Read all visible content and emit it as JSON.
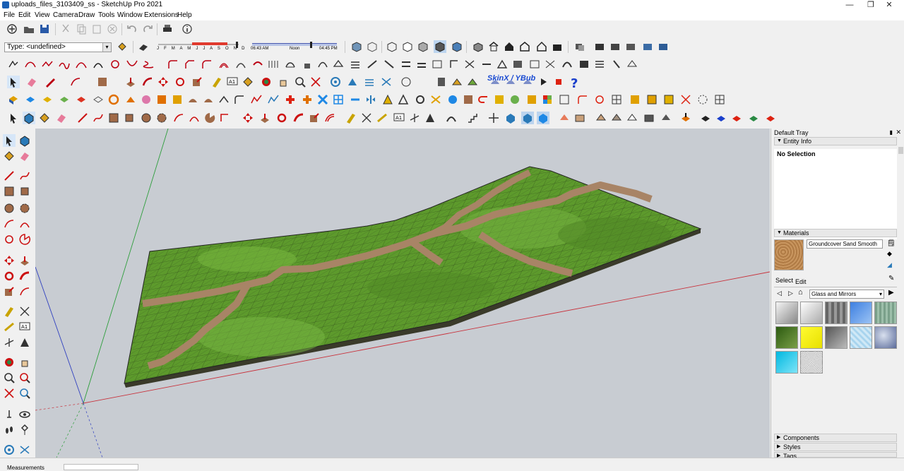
{
  "window": {
    "title": "uploads_files_3103409_ss - SketchUp Pro 2021",
    "minimize": "—",
    "restore": "❐",
    "close": "✕"
  },
  "menu": [
    "File",
    "Edit",
    "View",
    "Camera",
    "Draw",
    "Tools",
    "Window",
    "Extensions",
    "Help"
  ],
  "style_bar": {
    "type_value": "Type: <undefined>",
    "months": "J F M A M J J A S O N D",
    "time_start": "06:43 AM",
    "time_noon": "Noon",
    "time_end": "04:45 PM"
  },
  "plugin_label": "SkinX / YBub",
  "tray": {
    "title": "Default Tray",
    "entity_info": {
      "header": "Entity Info",
      "status": "No Selection"
    },
    "materials": {
      "header": "Materials",
      "material_name": "Groundcover Sand Smooth",
      "tab_select": "Select",
      "tab_edit": "Edit",
      "library": "Glass and Mirrors"
    },
    "components": "Components",
    "styles": "Styles",
    "tags": "Tags"
  },
  "measurements": {
    "label": "Measurements"
  },
  "colors": {
    "terrain_green": "#5d9a2c",
    "path_brown": "#a88466",
    "sky": "#c8ccd2"
  }
}
